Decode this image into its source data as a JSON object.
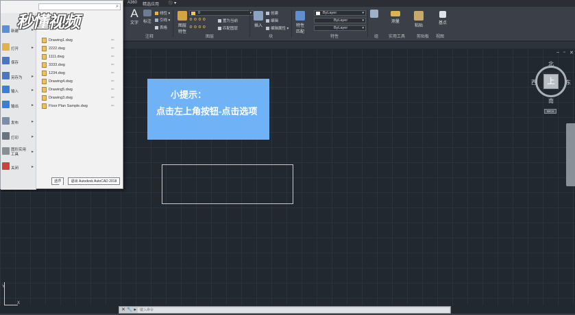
{
  "titlebar": {
    "tabs": [
      "A360",
      "精选应用"
    ]
  },
  "ribbon": {
    "groups": [
      "注释",
      "图层",
      "块",
      "特性",
      "组",
      "实用工具",
      "剪贴板",
      "视图"
    ],
    "buttons": {
      "text": "文字",
      "dimension": "标注",
      "linear": "线性",
      "leader": "引线",
      "table": "表格",
      "layer_props": "图层特性",
      "make_current": "置为当前",
      "match_layer": "匹配图层",
      "insert": "插入",
      "create": "创建",
      "edit": "编辑",
      "edit_attr": "编辑属性",
      "match_props": "特性匹配",
      "measure": "测量",
      "paste": "粘贴",
      "base": "基点"
    },
    "layer_combo": "0",
    "color_combo": "ByLayer",
    "linetype_combo": "ByLayer",
    "lineweight_combo": "ByLayer"
  },
  "app_menu": {
    "search_placeholder": "",
    "items": [
      {
        "label": "新建",
        "icon": "new-file-icon",
        "color": "#5a8fd8"
      },
      {
        "label": "打开",
        "icon": "open-folder-icon",
        "color": "#e2b34a"
      },
      {
        "label": "保存",
        "icon": "save-icon",
        "color": "#4a78c0"
      },
      {
        "label": "另存为",
        "icon": "save-as-icon",
        "color": "#4a78c0"
      },
      {
        "label": "输入",
        "icon": "import-icon",
        "color": "#3a7ed8"
      },
      {
        "label": "输出",
        "icon": "export-icon",
        "color": "#3a7ed8"
      },
      {
        "label": "发布",
        "icon": "publish-icon",
        "color": "#7a8ea5"
      },
      {
        "label": "打印",
        "icon": "print-icon",
        "color": "#6a7480"
      },
      {
        "label": "图形实用工具",
        "icon": "drawing-utilities-icon",
        "color": "#8a8f96"
      },
      {
        "label": "关闭",
        "icon": "close-file-icon",
        "color": "#c8443c"
      }
    ],
    "recent_files": [
      "Drawing1.dwg",
      "2222.dwg",
      "1111.dwg",
      "3333.dwg",
      "1234.dwg",
      "Drawing4.dwg",
      "Drawing5.dwg",
      "Drawing3.dwg",
      "Floor Plan Sample.dwg"
    ],
    "options_label": "选项",
    "exit_label": "退出 Autodesk AutoCAD 2018"
  },
  "watermark": {
    "logo": "秒懂视频",
    "sub": ""
  },
  "tip": {
    "title": "小提示：",
    "body": "点击左上角按钮-点击选项"
  },
  "viewcube": {
    "north": "北",
    "south": "南",
    "east": "东",
    "west": "西",
    "top": "上",
    "wcs": "WCS"
  },
  "ucs": {
    "x": "X",
    "y": "Y"
  },
  "command": {
    "placeholder": "键入命令"
  },
  "colors": {
    "canvas": "#212830",
    "ribbon": "#3b4048",
    "tip": "#6fb3f6"
  }
}
